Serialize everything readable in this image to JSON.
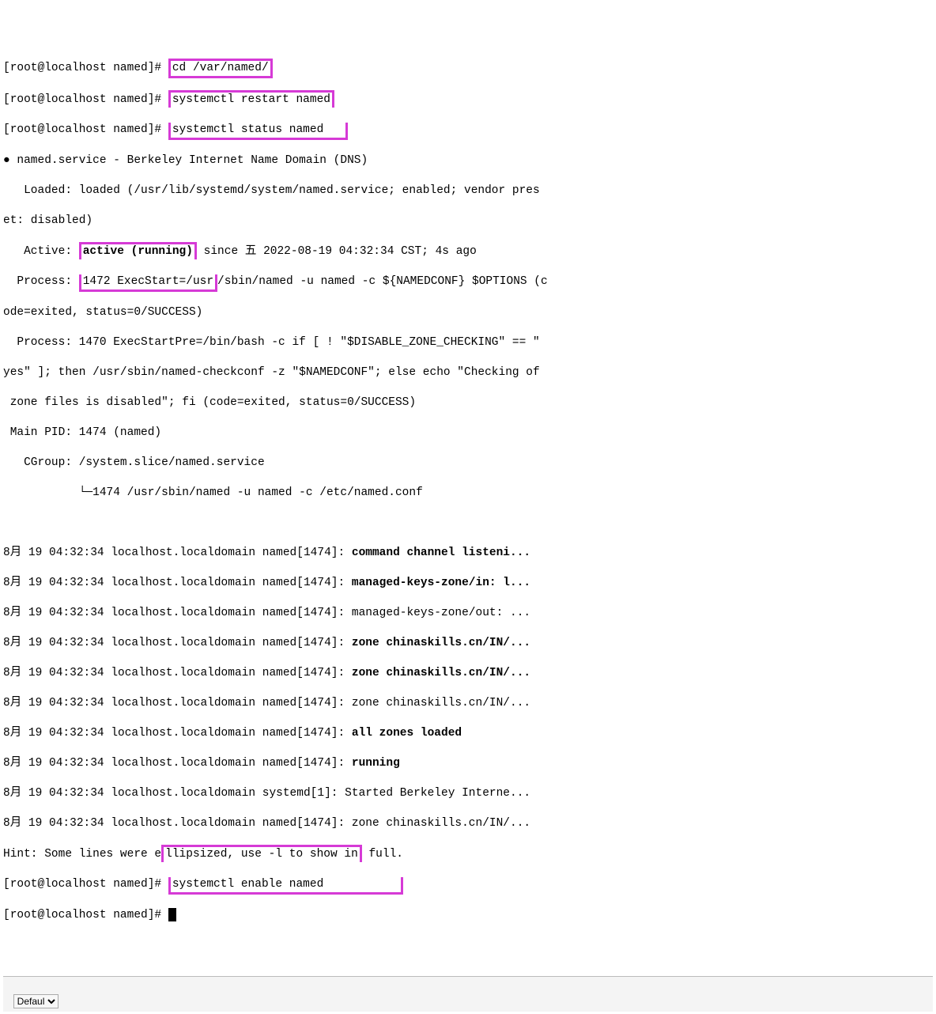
{
  "prompts": {
    "p1": "[root@localhost named]# ",
    "p2": "[root@localhost named]# ",
    "p3": "[root@localhost named]# ",
    "p4": "[root@localhost named]# ",
    "p5": "[root@localhost named]#"
  },
  "cmds": {
    "cd": "cd /var/named/",
    "restart": "systemctl restart named",
    "status": "systemctl status named",
    "enable": "systemctl enable named"
  },
  "status": {
    "bullet": "●",
    "unit": " named.service - Berkeley Internet Name Domain (DNS)",
    "loaded": "   Loaded: loaded (/usr/lib/systemd/system/named.service; enabled; vendor pres",
    "loaded2": "et: disabled)",
    "active_lbl": "   Active: ",
    "active_val": "active (running)",
    "active_rest": " since 五 2022-08-19 04:32:34 CST; 4s ago",
    "proc1a": "  Process: ",
    "proc1b": "1472 ExecStart=/usr",
    "proc1c": "/sbin/named -u named -c ${NAMEDCONF} $OPTIONS (c",
    "proc1d": "ode=exited, status=0/SUCCESS)",
    "proc2a": "  Process: 1470 ExecStartPre=/bin/bash -c if [ ! \"$DISABLE_ZONE_CHECKING\" == \"",
    "proc2b": "yes\" ]; then /usr/sbin/named-checkconf -z \"$NAMEDCONF\"; else echo \"Checking of",
    "proc2c": " zone files is disabled\"; fi (code=exited, status=0/SUCCESS)",
    "mainpid": " Main PID: 1474 (named)",
    "cgroup": "   CGroup: /system.slice/named.service",
    "cgroup2": "           └─1474 /usr/sbin/named -u named -c /etc/named.conf"
  },
  "logs": {
    "l1p": "8月 19 04:32:34 localhost.localdomain named[1474]: ",
    "l1m": "command channel listeni...",
    "l2p": "8月 19 04:32:34 localhost.localdomain named[1474]: ",
    "l2m": "managed-keys-zone/in: l...",
    "l3": "8月 19 04:32:34 localhost.localdomain named[1474]: managed-keys-zone/out: ...",
    "l4p": "8月 19 04:32:34 localhost.localdomain named[1474]: ",
    "l4m": "zone chinaskills.cn/IN/...",
    "l5p": "8月 19 04:32:34 localhost.localdomain named[1474]: ",
    "l5m": "zone chinaskills.cn/IN/...",
    "l6": "8月 19 04:32:34 localhost.localdomain named[1474]: zone chinaskills.cn/IN/...",
    "l7p": "8月 19 04:32:34 localhost.localdomain named[1474]: ",
    "l7m": "all zones loaded",
    "l8p": "8月 19 04:32:34 localhost.localdomain named[1474]: ",
    "l8m": "running",
    "l9": "8月 19 04:32:34 localhost.localdomain systemd[1]: Started Berkeley Interne...",
    "l10": "8月 19 04:32:34 localhost.localdomain named[1474]: zone chinaskills.cn/IN/...",
    "hintA": "Hint: Some lines were e",
    "hintB": "llipsized, use -l to show in",
    "hintC": " full."
  },
  "footer": {
    "select": "Defaul"
  }
}
